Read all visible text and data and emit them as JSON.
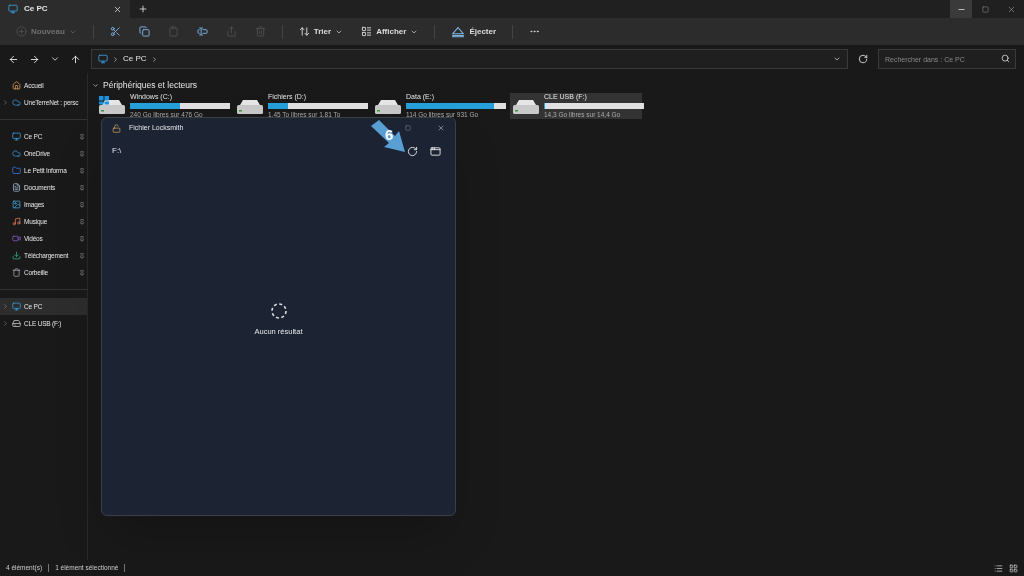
{
  "tabs": [
    {
      "label": "Ce PC",
      "selected": true
    }
  ],
  "toolbar": [
    {
      "kind": "new",
      "label": "Nouveau",
      "disabled": true
    },
    {
      "kind": "cut",
      "disabled": false
    },
    {
      "kind": "copy",
      "disabled": false
    },
    {
      "kind": "paste",
      "disabled": true
    },
    {
      "kind": "rename",
      "disabled": false
    },
    {
      "kind": "share",
      "disabled": true
    },
    {
      "kind": "delete",
      "disabled": true
    },
    {
      "kind": "sort",
      "label": "Trier",
      "disabled": false
    },
    {
      "kind": "view",
      "label": "Afficher",
      "disabled": false
    },
    {
      "kind": "eject",
      "label": "Éjecter",
      "disabled": false
    },
    {
      "kind": "more",
      "disabled": false
    }
  ],
  "address": {
    "crumbs": [
      "Ce PC"
    ]
  },
  "search": {
    "placeholder": "Rechercher dans : Ce PC"
  },
  "sidebar": {
    "groups": [
      [
        {
          "label": "Accueil",
          "pinned": false,
          "expandable": false,
          "selected": false
        },
        {
          "label": "UneTerreNet : persc",
          "pinned": false,
          "expandable": true,
          "selected": false
        }
      ],
      [
        {
          "label": "Ce PC",
          "pinned": true,
          "expandable": false,
          "selected": false
        },
        {
          "label": "OneDrive",
          "pinned": true,
          "expandable": false,
          "selected": false
        },
        {
          "label": "Le Petit Informa",
          "pinned": true,
          "expandable": false,
          "selected": false
        },
        {
          "label": "Documents",
          "pinned": true,
          "expandable": false,
          "selected": false
        },
        {
          "label": "Images",
          "pinned": true,
          "expandable": false,
          "selected": false
        },
        {
          "label": "Musique",
          "pinned": true,
          "expandable": false,
          "selected": false
        },
        {
          "label": "Vidéos",
          "pinned": true,
          "expandable": false,
          "selected": false
        },
        {
          "label": "Téléchargement",
          "pinned": true,
          "expandable": false,
          "selected": false
        },
        {
          "label": "Corbeille",
          "pinned": true,
          "expandable": false,
          "selected": false
        }
      ],
      [
        {
          "label": "Ce PC",
          "pinned": false,
          "expandable": true,
          "selected": true
        },
        {
          "label": "CLE USB (F:)",
          "pinned": false,
          "expandable": true,
          "selected": false
        }
      ]
    ]
  },
  "section": {
    "title": "Périphériques et lecteurs",
    "expanded": true
  },
  "drives": [
    {
      "name": "Windows (C:)",
      "detail": "240 Go libres sur 476 Go",
      "level": 0.5,
      "system": true,
      "selected": false
    },
    {
      "name": "Fichiers (D:)",
      "detail": "1,45 To libres sur 1,81 To",
      "level": 0.2,
      "system": false,
      "selected": false
    },
    {
      "name": "Data (E:)",
      "detail": "114 Go libres sur 931 Go",
      "level": 0.88,
      "system": false,
      "selected": false
    },
    {
      "name": "CLE USB (F:)",
      "detail": "14,3 Go libres sur 14,4 Go",
      "level": 0.01,
      "system": false,
      "selected": true
    }
  ],
  "dialog": {
    "title": "Fichier Locksmith",
    "path": "F:\\",
    "empty_text": "Aucun résultat"
  },
  "annotation": {
    "label": "6"
  },
  "status_bar": {
    "items": [
      "4 élément(s)",
      "1 élément sélectionné"
    ]
  }
}
